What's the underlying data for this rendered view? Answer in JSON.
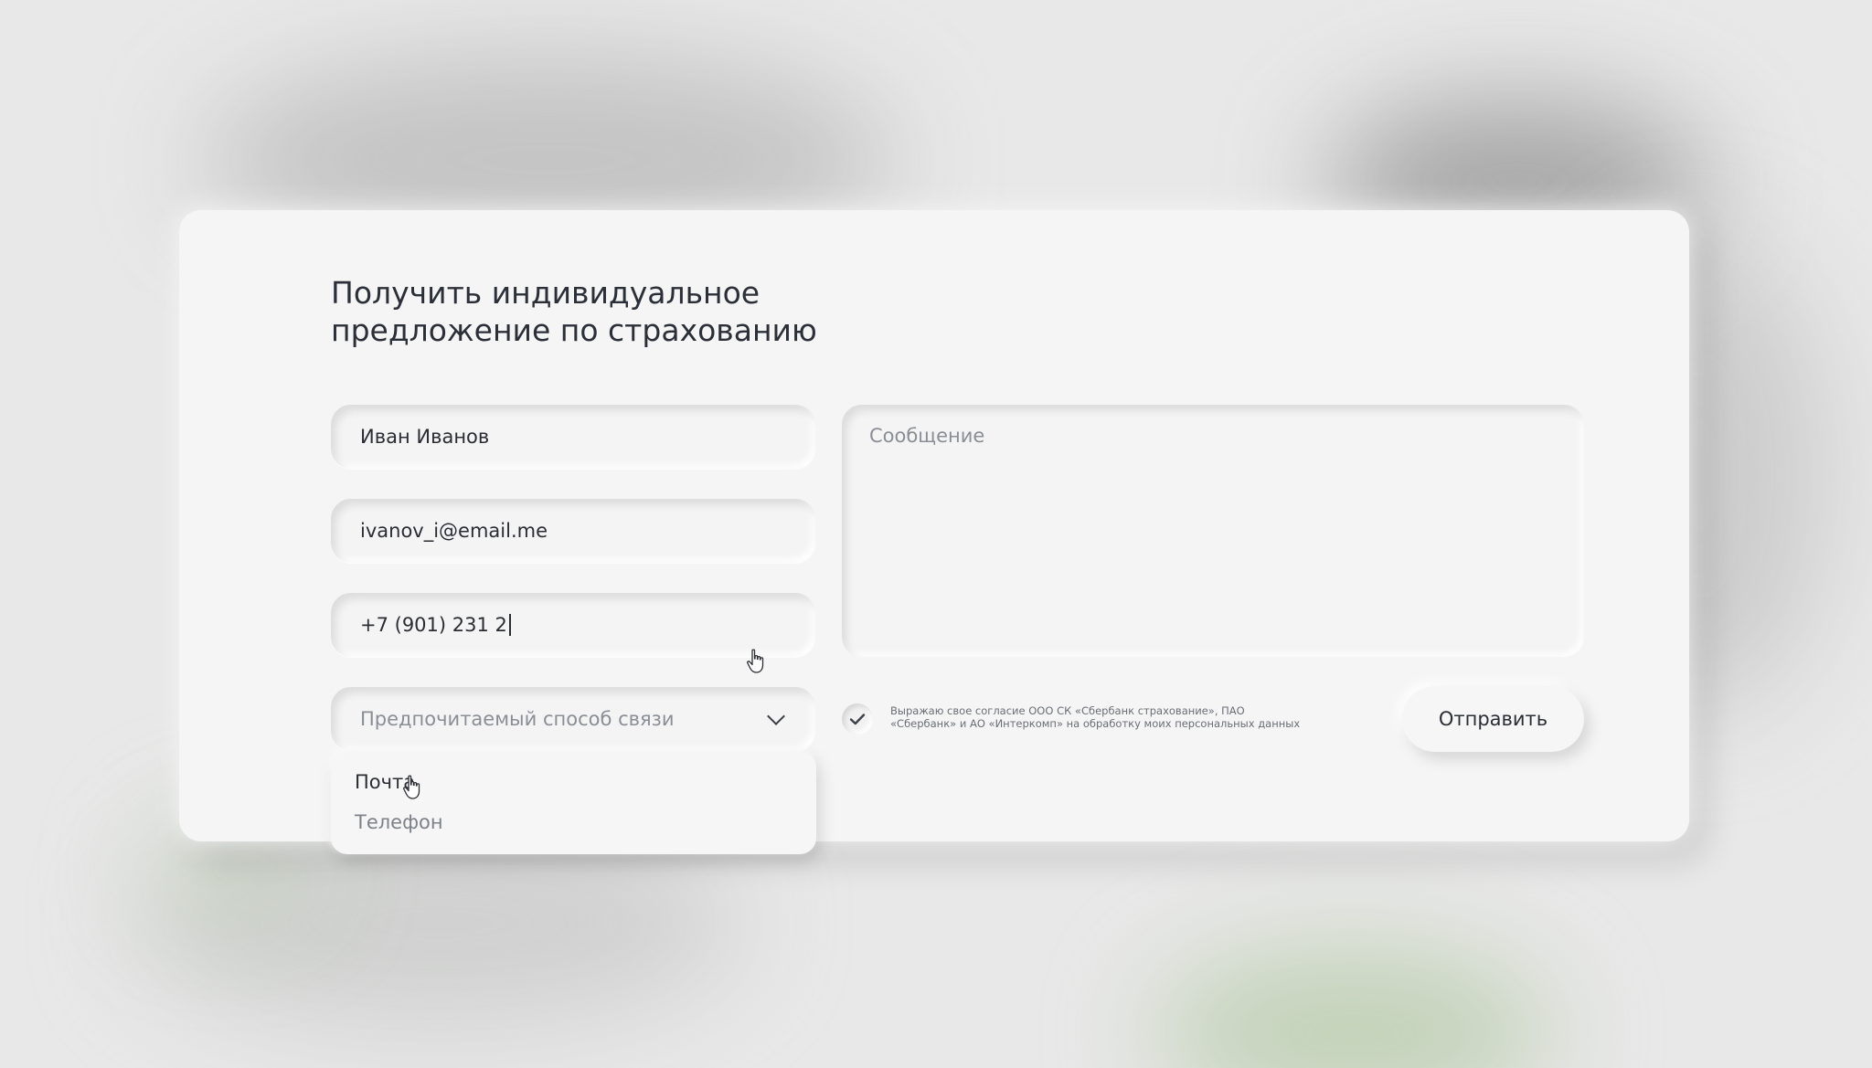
{
  "form": {
    "title": "Получить индивидуальное предложение по страхованию",
    "name_value": "Иван Иванов",
    "email_value": "ivanov_i@email.me",
    "phone_value": "+7 (901) 231 2",
    "contact_select": {
      "placeholder": "Предпочитаемый способ связи",
      "options": [
        "Почта",
        "Телефон"
      ]
    },
    "message_placeholder": "Сообщение",
    "consent_text": "Выражаю свое согласие ООО СК «Сбербанк страхование», ПАО «Сбербанк» и АО «Интеркомп» на обработку моих персональных данных",
    "consent_checked": true,
    "submit_label": "Отправить"
  },
  "icons": {
    "check": "check-icon",
    "chevron": "chevron-down-icon",
    "cursor": "hand-cursor-icon"
  },
  "colors": {
    "background": "#e8e8e8",
    "card": "#f5f5f5",
    "text": "#2a2d33",
    "placeholder": "#8a8e95"
  }
}
